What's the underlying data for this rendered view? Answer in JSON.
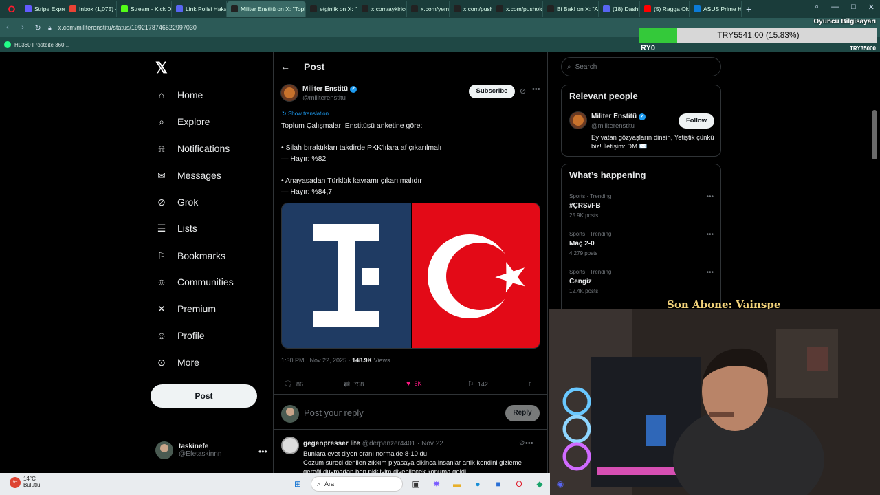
{
  "browser": {
    "tabs": [
      {
        "title": "Stripe Express",
        "color": "#635bff"
      },
      {
        "title": "Inbox (1,075) -",
        "color": "#ea4335"
      },
      {
        "title": "Stream - Kick D",
        "color": "#53fc18"
      },
      {
        "title": "Link Polisi Hakal",
        "color": "#5865f2"
      },
      {
        "title": "Militer Enstitü on X: \"Topl",
        "color": "#222222"
      },
      {
        "title": "etginlik on X: \"",
        "color": "#222222"
      },
      {
        "title": "x.com/aykiricon",
        "color": "#222222"
      },
      {
        "title": "x.com/yemekter",
        "color": "#222222"
      },
      {
        "title": "x.com/pusholde",
        "color": "#222222"
      },
      {
        "title": "x.com/pusholde",
        "color": "#222222"
      },
      {
        "title": "Bi Bak! on X: \"A",
        "color": "#222222"
      },
      {
        "title": "(18) Dashboard",
        "color": "#5865f2"
      },
      {
        "title": "(5) Ragga Oktay",
        "color": "#ff0000"
      },
      {
        "title": "ASUS Prime H6",
        "color": "#0b7bd8"
      }
    ],
    "url": "x.com/militerenstitu/status/1992178746522997030",
    "bookmark": "HL360 Frostbite 360...",
    "profile_label": "Oyuncu Bilgisayarı"
  },
  "donation": {
    "text": "TRY5541.00 (15.83%)",
    "progress": 0.1583,
    "min": "RY0",
    "max": "TRY35000"
  },
  "nav": {
    "items": [
      {
        "label": "Home",
        "icon": "home-icon"
      },
      {
        "label": "Explore",
        "icon": "search-icon"
      },
      {
        "label": "Notifications",
        "icon": "bell-icon"
      },
      {
        "label": "Messages",
        "icon": "mail-icon"
      },
      {
        "label": "Grok",
        "icon": "grok-icon"
      },
      {
        "label": "Lists",
        "icon": "list-icon"
      },
      {
        "label": "Bookmarks",
        "icon": "bookmark-icon"
      },
      {
        "label": "Communities",
        "icon": "people-icon"
      },
      {
        "label": "Premium",
        "icon": "x-icon"
      },
      {
        "label": "Profile",
        "icon": "person-icon"
      },
      {
        "label": "More",
        "icon": "more-circle-icon"
      }
    ],
    "post_button": "Post",
    "user": {
      "name": "taskinefe",
      "handle": "@Efetaskinnn"
    }
  },
  "post": {
    "header": "Post",
    "author": "Militer Enstitü",
    "handle": "@militerenstitu",
    "subscribe": "Subscribe",
    "show_translation": "Show translation",
    "lines": [
      "Toplum Çalışmaları Enstitüsü anketine göre:",
      "• Silah bıraktıkları takdirde PKK'lılara af çıkarılmalı",
      "— Hayır: %82",
      "• Anayasadan Türklük kavramı çıkarılmalıdır",
      "— Hayır: %84,7"
    ],
    "time": "1:30 PM · Nov 22, 2025 · ",
    "views_count": "148.9K",
    "views_label": " Views",
    "stats": {
      "replies": "86",
      "reposts": "758",
      "likes": "6K",
      "bookmarks": "142"
    },
    "reply_placeholder": "Post your reply",
    "reply_button": "Reply"
  },
  "comment": {
    "name": "gegenpresser lite",
    "handle": "@derpanzer4401 · Nov 22",
    "lines": [
      "Bunlara evet diyen oranı normalde 8-10 du",
      "Cozum sureci denilen zıkkım piyasaya cikinca insanlar artik kendini gizleme",
      "gereği duymadan ben pkkliyim diyebilecek konuma geldi"
    ]
  },
  "right": {
    "search_placeholder": "Search",
    "relevant_title": "Relevant people",
    "relevant": {
      "name": "Militer Enstitü",
      "handle": "@militerenstitu",
      "follow": "Follow",
      "bio": "Ey vatan gözyaşların dinsin, Yetiştik çünkü biz! İletişim: DM ✉️"
    },
    "happening_title": "What’s happening",
    "trends": [
      {
        "category": "Sports · Trending",
        "name": "#ÇRSvFB",
        "count": "25.9K posts"
      },
      {
        "category": "Sports · Trending",
        "name": "Maç 2-0",
        "count": "4,279 posts"
      },
      {
        "category": "Sports · Trending",
        "name": "Cengiz",
        "count": "12.4K posts"
      }
    ]
  },
  "stream": {
    "last_sub": "Son Abone: Vainspe"
  },
  "taskbar": {
    "temp": "14°C",
    "condition": "Bulutlu",
    "search": "Ara"
  },
  "colors": {
    "accent": "#1d9bf0",
    "like": "#f91880",
    "flag_red": "#e30a17",
    "ite_blue": "#1f3b63"
  }
}
